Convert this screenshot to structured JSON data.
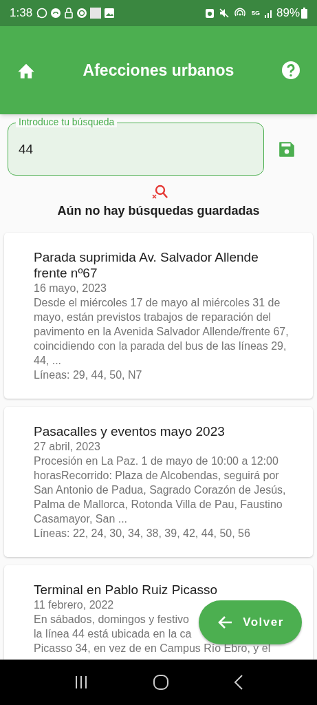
{
  "status_bar": {
    "time": "1:38",
    "network": "5G",
    "battery": "89%"
  },
  "app_bar": {
    "title": "Afecciones urbanos"
  },
  "search": {
    "label": "Introduce tu búsqueda",
    "value": "44"
  },
  "saved_searches": {
    "empty_message": "Aún no hay búsquedas guardadas"
  },
  "cards": [
    {
      "title": "Parada suprimida Av. Salvador Allende frente nº67",
      "date": "16 mayo, 2023",
      "description": [
        "Desde el miércoles 17 de mayo al miércoles 31 de mayo, están previstos trabajos de reparación del pavimento en la Avenida Salvador Allende/frente 67, coincidiendo con la parada del bus de las líneas 29, 44, ..."
      ],
      "lines": "Líneas: 29, 44, 50, N7"
    },
    {
      "title": "Pasacalles y eventos mayo 2023",
      "date": "27 abril, 2023",
      "description": [
        "Procesión en La Paz. 1 de mayo de 10:00 a 12:00 horasRecorrido: Plaza de Alcobendas, seguirá por San Antonio de Padua, Sagrado Corazón de Jesús, Palma de Mallorca, Rotonda Villa de Pau, Faustino Casamayor, San ..."
      ],
      "lines": "Líneas: 22, 24, 30, 34, 38, 39, 42, 44, 50, 56"
    },
    {
      "title": "Terminal en Pablo Ruiz Picasso",
      "date": "11 febrero, 2022",
      "description": [
        "En sábados, domingos y festivo",
        "la línea 44 está ubicada en la ca",
        "Picasso 34, en vez de en Campus Río Ebro, y el"
      ]
    }
  ],
  "fab": {
    "label": "Volver"
  }
}
